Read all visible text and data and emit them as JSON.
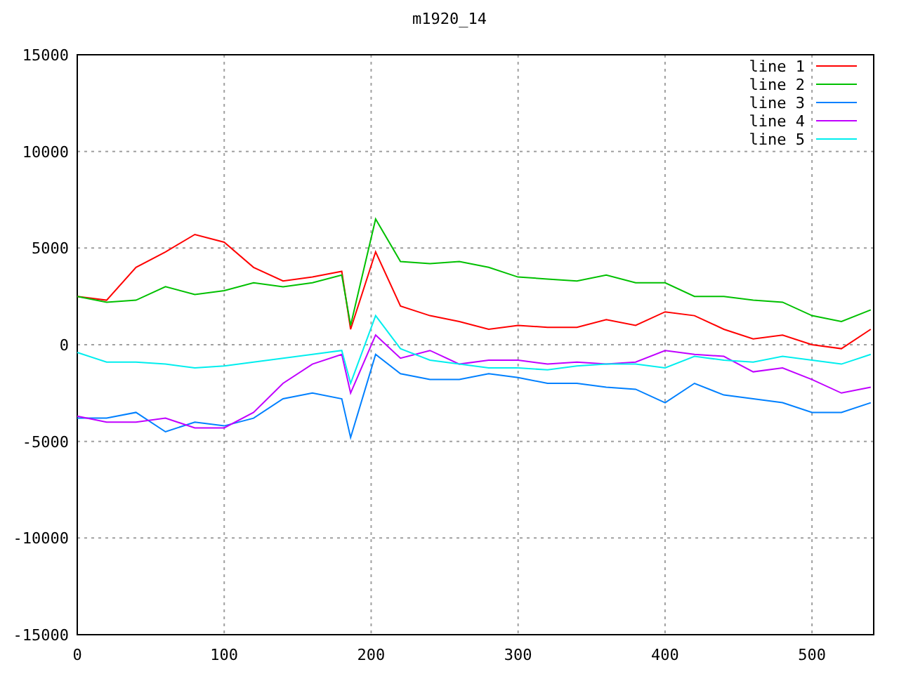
{
  "chart_data": {
    "type": "line",
    "title": "m1920_14",
    "x": [
      0,
      20,
      40,
      60,
      80,
      100,
      120,
      140,
      160,
      180,
      186,
      203,
      220,
      240,
      260,
      280,
      300,
      320,
      340,
      360,
      380,
      400,
      420,
      440,
      460,
      480,
      500,
      520,
      540
    ],
    "series": [
      {
        "name": "line 1",
        "color": "#ff0000",
        "values": [
          2500,
          2300,
          4000,
          4800,
          5700,
          5300,
          4000,
          3300,
          3500,
          3800,
          800,
          4800,
          2000,
          1500,
          1200,
          800,
          1000,
          900,
          900,
          1300,
          1000,
          1700,
          1500,
          800,
          300,
          500,
          0,
          -200,
          800
        ]
      },
      {
        "name": "line 2",
        "color": "#00c000",
        "values": [
          2500,
          2200,
          2300,
          3000,
          2600,
          2800,
          3200,
          3000,
          3200,
          3600,
          1000,
          6500,
          4300,
          4200,
          4300,
          4000,
          3500,
          3400,
          3300,
          3600,
          3200,
          3200,
          2500,
          2500,
          2300,
          2200,
          1500,
          1200,
          1800
        ]
      },
      {
        "name": "line 3",
        "color": "#0080ff",
        "values": [
          -3800,
          -3800,
          -3500,
          -4500,
          -4000,
          -4200,
          -3800,
          -2800,
          -2500,
          -2800,
          -4800,
          -500,
          -1500,
          -1800,
          -1800,
          -1500,
          -1700,
          -2000,
          -2000,
          -2200,
          -2300,
          -3000,
          -2000,
          -2600,
          -2800,
          -3000,
          -3500,
          -3500,
          -3000
        ]
      },
      {
        "name": "line 4",
        "color": "#c000ff",
        "values": [
          -3700,
          -4000,
          -4000,
          -3800,
          -4300,
          -4300,
          -3500,
          -2000,
          -1000,
          -500,
          -2500,
          500,
          -700,
          -300,
          -1000,
          -800,
          -800,
          -1000,
          -900,
          -1000,
          -900,
          -300,
          -500,
          -600,
          -1400,
          -1200,
          -1800,
          -2500,
          -2200
        ]
      },
      {
        "name": "line 5",
        "color": "#00eeee",
        "values": [
          -400,
          -900,
          -900,
          -1000,
          -1200,
          -1100,
          -900,
          -700,
          -500,
          -300,
          -2000,
          1500,
          -200,
          -800,
          -1000,
          -1200,
          -1200,
          -1300,
          -1100,
          -1000,
          -1000,
          -1200,
          -600,
          -800,
          -900,
          -600,
          -800,
          -1000,
          -500
        ]
      }
    ],
    "xlim": [
      0,
      542
    ],
    "ylim": [
      -15000,
      15000
    ],
    "xticks": [
      0,
      100,
      200,
      300,
      400,
      500
    ],
    "yticks": [
      -15000,
      -10000,
      -5000,
      0,
      5000,
      10000,
      15000
    ],
    "grid": true,
    "legend": true
  }
}
